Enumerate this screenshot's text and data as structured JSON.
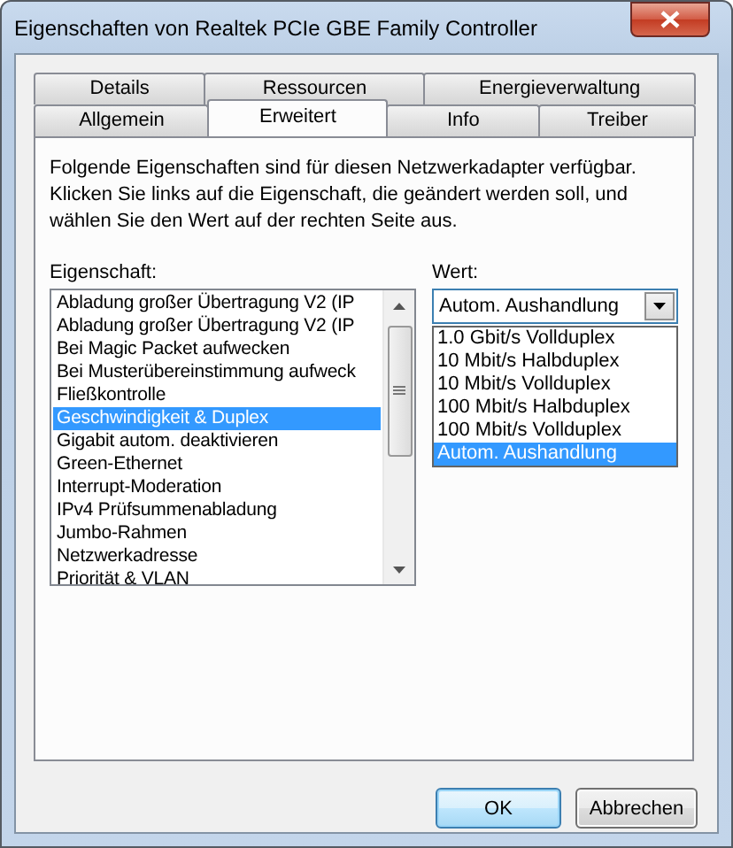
{
  "window": {
    "title": "Eigenschaften von Realtek PCIe GBE Family Controller"
  },
  "tab_rows": [
    [
      {
        "label": "Details",
        "selected": false
      },
      {
        "label": "Ressourcen",
        "selected": false
      },
      {
        "label": "Energieverwaltung",
        "selected": false
      }
    ],
    [
      {
        "label": "Allgemein",
        "selected": false
      },
      {
        "label": "Erweitert",
        "selected": true
      },
      {
        "label": "Info",
        "selected": false
      },
      {
        "label": "Treiber",
        "selected": false
      }
    ]
  ],
  "description": "Folgende Eigenschaften sind für diesen Netzwerkadapter verfügbar.\nKlicken Sie links auf die Eigenschaft, die geändert werden soll, und\nwählen Sie den Wert auf der rechten Seite aus.",
  "property": {
    "label": "Eigenschaft:",
    "items": [
      {
        "text": "Abladung großer Übertragung V2 (IP",
        "selected": false
      },
      {
        "text": "Abladung großer Übertragung V2 (IP",
        "selected": false
      },
      {
        "text": "Bei Magic Packet aufwecken",
        "selected": false
      },
      {
        "text": "Bei Musterübereinstimmung aufweck",
        "selected": false
      },
      {
        "text": "Fließkontrolle",
        "selected": false
      },
      {
        "text": "Geschwindigkeit & Duplex",
        "selected": true
      },
      {
        "text": "Gigabit autom. deaktivieren",
        "selected": false
      },
      {
        "text": "Green-Ethernet",
        "selected": false
      },
      {
        "text": "Interrupt-Moderation",
        "selected": false
      },
      {
        "text": "IPv4 Prüfsummenabladung",
        "selected": false
      },
      {
        "text": "Jumbo-Rahmen",
        "selected": false
      },
      {
        "text": "Netzwerkadresse",
        "selected": false
      },
      {
        "text": "Priorität & VLAN",
        "selected": false
      }
    ]
  },
  "value": {
    "label": "Wert:",
    "combo": {
      "value": "Autom. Aushandlung",
      "expanded": true
    },
    "options": [
      {
        "text": "1.0 Gbit/s Vollduplex",
        "selected": false
      },
      {
        "text": "10 Mbit/s Halbduplex",
        "selected": false
      },
      {
        "text": "10 Mbit/s Vollduplex",
        "selected": false
      },
      {
        "text": "100 Mbit/s Halbduplex",
        "selected": false
      },
      {
        "text": "100 Mbit/s Vollduplex",
        "selected": false
      },
      {
        "text": "Autom. Aushandlung",
        "selected": true
      }
    ]
  },
  "buttons": [
    {
      "label": "OK",
      "default": true
    },
    {
      "label": "Abbrechen",
      "default": false
    }
  ]
}
